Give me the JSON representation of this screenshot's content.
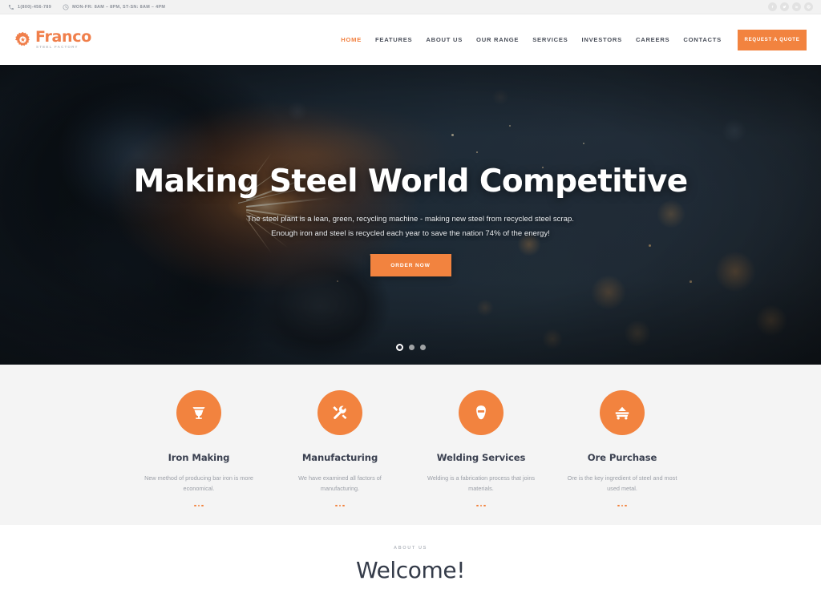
{
  "topbar": {
    "phone": "1(800)-456-789",
    "phone_icon": "phone-icon",
    "hours": "MON-FR: 8AM – 8PM, ST-SN: 8AM – 4PM",
    "hours_icon": "clock-icon",
    "social": [
      {
        "name": "facebook-icon",
        "glyph": "f"
      },
      {
        "name": "twitter-icon",
        "glyph": "t"
      },
      {
        "name": "linkedin-icon",
        "glyph": "in"
      },
      {
        "name": "pinterest-icon",
        "glyph": "p"
      }
    ]
  },
  "header": {
    "logo_icon": "gear-icon",
    "logo_name": "Franco",
    "logo_sub": "STEEL FACTORY",
    "nav": [
      {
        "label": "HOME",
        "active": true
      },
      {
        "label": "FEATURES",
        "active": false
      },
      {
        "label": "ABOUT US",
        "active": false
      },
      {
        "label": "OUR RANGE",
        "active": false
      },
      {
        "label": "SERVICES",
        "active": false
      },
      {
        "label": "INVESTORS",
        "active": false
      },
      {
        "label": "CAREERS",
        "active": false
      },
      {
        "label": "CONTACTS",
        "active": false
      }
    ],
    "quote_button": "REQUEST A QUOTE"
  },
  "hero": {
    "title": "Making Steel World Competitive",
    "subtitle_line1": "The steel plant is a lean, green, recycling machine - making new steel from recycled steel scrap.",
    "subtitle_line2": "Enough iron and steel is recycled each year to save the nation 74% of the energy!",
    "cta": "ORDER NOW",
    "slides": 3,
    "active_slide": 1
  },
  "services": [
    {
      "icon": "crucible-icon",
      "title": "Iron Making",
      "desc": "New method of producing bar iron is more economical."
    },
    {
      "icon": "hammer-wrench-icon",
      "title": "Manufacturing",
      "desc": "We have examined all factors of manufacturing."
    },
    {
      "icon": "welding-mask-icon",
      "title": "Welding Services",
      "desc": "Welding is a fabrication process that joins materials."
    },
    {
      "icon": "ore-cart-icon",
      "title": "Ore Purchase",
      "desc": "Ore is the key ingredient of steel and most used metal."
    }
  ],
  "about": {
    "label": "ABOUT US",
    "title": "Welcome!"
  },
  "colors": {
    "accent": "#f2833f",
    "topbar_bg": "#f2f2f2",
    "services_bg": "#f4f4f4",
    "heading": "#3a4050",
    "muted": "#9b9fa7"
  }
}
